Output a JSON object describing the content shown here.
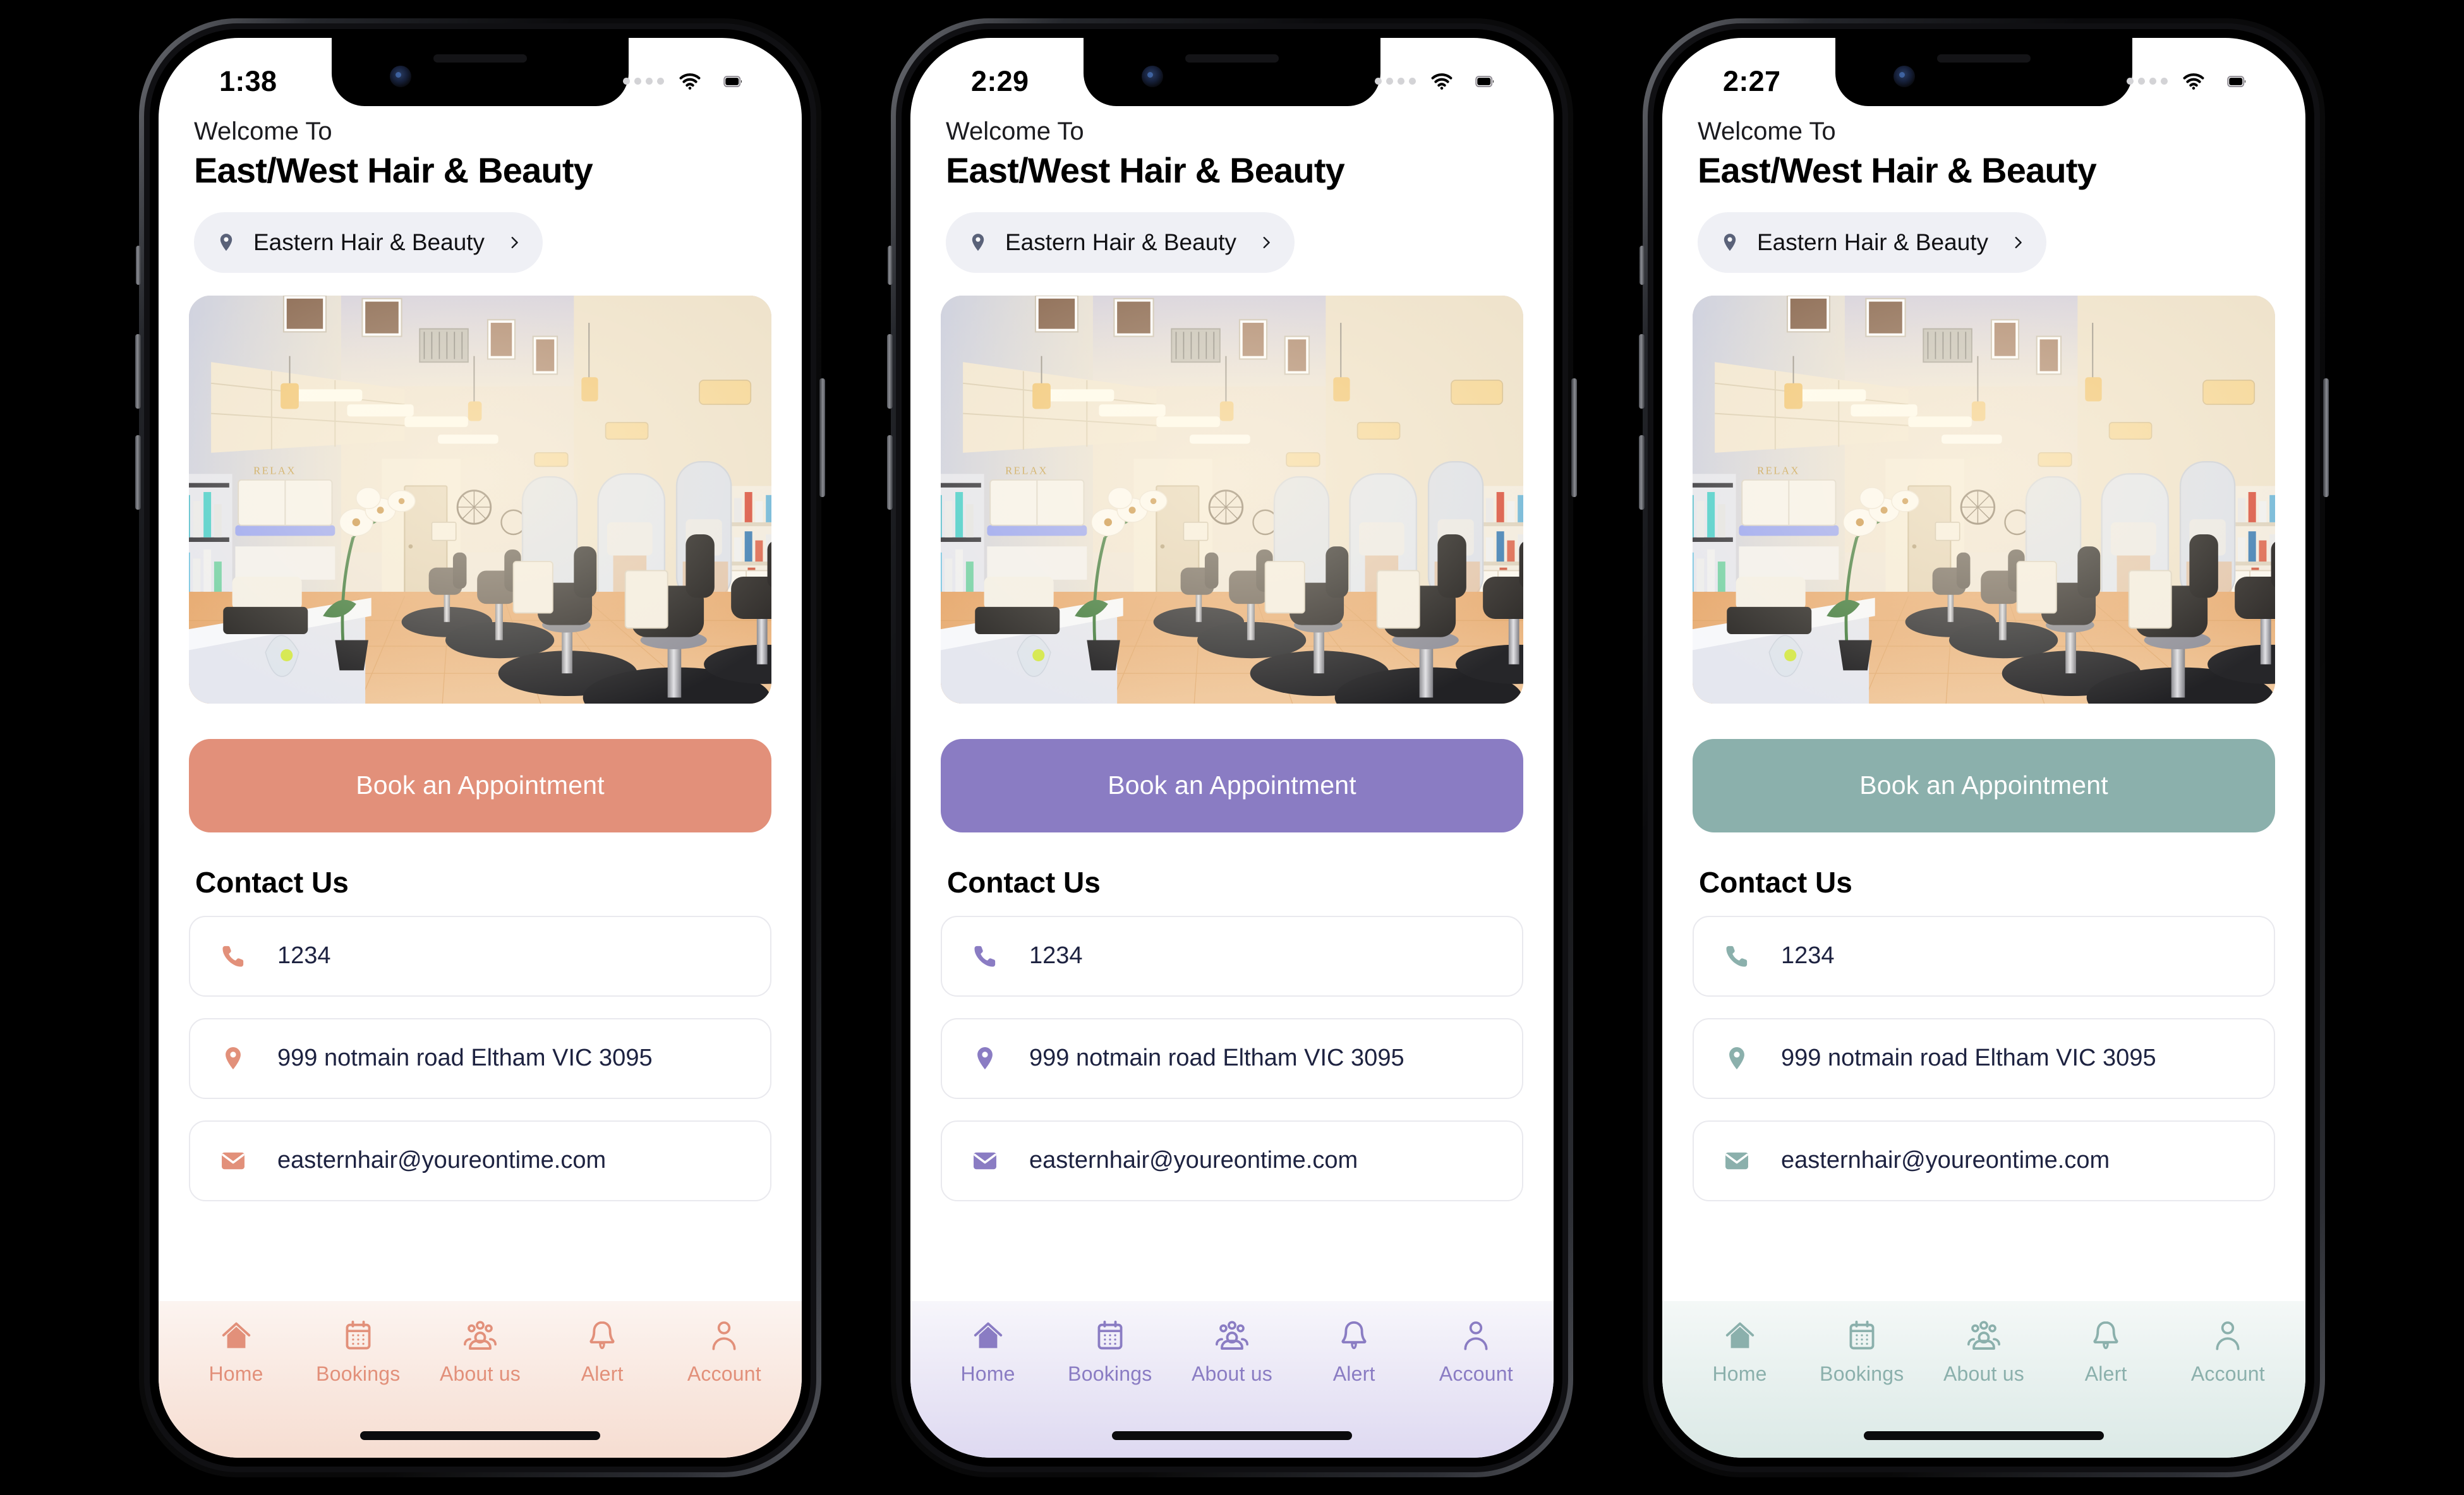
{
  "screens": [
    {
      "id": "coral",
      "status": {
        "time": "1:38",
        "signal_icon": "signal-dots-icon",
        "wifi_icon": "wifi-icon",
        "battery_icon": "battery-full-icon"
      },
      "header": {
        "welcome_label": "Welcome To",
        "business_name": "East/West Hair & Beauty"
      },
      "location": {
        "pin_icon": "map-pin-icon",
        "name": "Eastern Hair & Beauty",
        "chevron_icon": "chevron-right-icon"
      },
      "hero": {
        "alt": "salon-interior-photo"
      },
      "cta": {
        "label": "Book an Appointment"
      },
      "contact": {
        "title": "Contact Us",
        "rows": [
          {
            "icon": "phone-icon",
            "value": "1234"
          },
          {
            "icon": "map-pin-icon",
            "value": "999 notmain road Eltham VIC 3095"
          },
          {
            "icon": "envelope-icon",
            "value": "easternhair@youreontime.com"
          }
        ]
      },
      "tabs": [
        {
          "icon": "home-icon",
          "label": "Home",
          "active": true
        },
        {
          "icon": "calendar-icon",
          "label": "Bookings",
          "active": false
        },
        {
          "icon": "people-group-icon",
          "label": "About us",
          "active": false
        },
        {
          "icon": "bell-icon",
          "label": "Alert",
          "active": false
        },
        {
          "icon": "person-icon",
          "label": "Account",
          "active": false
        }
      ],
      "theme": {
        "accent": "#e2907a",
        "accent_soft": "#e9967f",
        "tabbar_top": "#fcf4f0",
        "tabbar_bottom": "#f6ddd1",
        "pin_color": "#5a6279"
      }
    },
    {
      "id": "purple",
      "status": {
        "time": "2:29",
        "signal_icon": "signal-dots-icon",
        "wifi_icon": "wifi-icon",
        "battery_icon": "battery-full-icon"
      },
      "header": {
        "welcome_label": "Welcome To",
        "business_name": "East/West Hair & Beauty"
      },
      "location": {
        "pin_icon": "map-pin-icon",
        "name": "Eastern Hair & Beauty",
        "chevron_icon": "chevron-right-icon"
      },
      "hero": {
        "alt": "salon-interior-photo"
      },
      "cta": {
        "label": "Book an Appointment"
      },
      "contact": {
        "title": "Contact Us",
        "rows": [
          {
            "icon": "phone-icon",
            "value": "1234"
          },
          {
            "icon": "map-pin-icon",
            "value": "999 notmain road Eltham VIC 3095"
          },
          {
            "icon": "envelope-icon",
            "value": "easternhair@youreontime.com"
          }
        ]
      },
      "tabs": [
        {
          "icon": "home-icon",
          "label": "Home",
          "active": true
        },
        {
          "icon": "calendar-icon",
          "label": "Bookings",
          "active": false
        },
        {
          "icon": "people-group-icon",
          "label": "About us",
          "active": false
        },
        {
          "icon": "bell-icon",
          "label": "Alert",
          "active": false
        },
        {
          "icon": "person-icon",
          "label": "Account",
          "active": false
        }
      ],
      "theme": {
        "accent": "#8a7cc3",
        "accent_soft": "#8d7fc6",
        "tabbar_top": "#f7f6fb",
        "tabbar_bottom": "#ded9f1",
        "pin_color": "#5a6279"
      }
    },
    {
      "id": "teal",
      "status": {
        "time": "2:27",
        "signal_icon": "signal-dots-icon",
        "wifi_icon": "wifi-icon",
        "battery_icon": "battery-full-icon"
      },
      "header": {
        "welcome_label": "Welcome To",
        "business_name": "East/West Hair & Beauty"
      },
      "location": {
        "pin_icon": "map-pin-icon",
        "name": "Eastern Hair & Beauty",
        "chevron_icon": "chevron-right-icon"
      },
      "hero": {
        "alt": "salon-interior-photo"
      },
      "cta": {
        "label": "Book an Appointment"
      },
      "contact": {
        "title": "Contact Us",
        "rows": [
          {
            "icon": "phone-icon",
            "value": "1234"
          },
          {
            "icon": "map-pin-icon",
            "value": "999 notmain road Eltham VIC 3095"
          },
          {
            "icon": "envelope-icon",
            "value": "easternhair@youreontime.com"
          }
        ]
      },
      "tabs": [
        {
          "icon": "home-icon",
          "label": "Home",
          "active": true
        },
        {
          "icon": "calendar-icon",
          "label": "Bookings",
          "active": false
        },
        {
          "icon": "people-group-icon",
          "label": "About us",
          "active": false
        },
        {
          "icon": "bell-icon",
          "label": "Alert",
          "active": false
        },
        {
          "icon": "person-icon",
          "label": "Account",
          "active": false
        }
      ],
      "theme": {
        "accent": "#8bb0ac",
        "accent_soft": "#8eb2ae",
        "tabbar_top": "#f4f8f7",
        "tabbar_bottom": "#dbe9e6",
        "pin_color": "#5a6279"
      }
    }
  ]
}
